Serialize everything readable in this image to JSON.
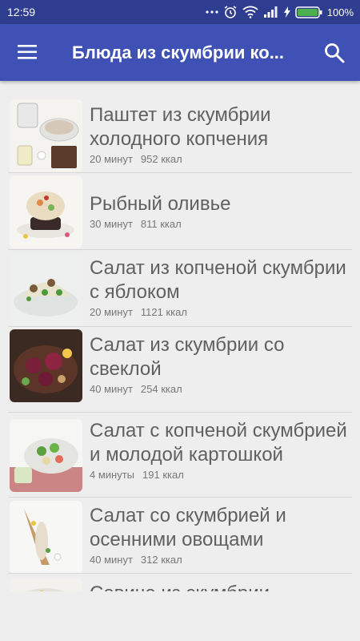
{
  "status": {
    "time": "12:59",
    "battery": "100%"
  },
  "appbar": {
    "title": "Блюда из скумбрии ко..."
  },
  "recipes": [
    {
      "name": "Паштет из скумбрии холодного копчения",
      "time": "20 минут",
      "kcal": "952 ккал"
    },
    {
      "name": "Рыбный оливье",
      "time": "30 минут",
      "kcal": "811 ккал"
    },
    {
      "name": "Салат из копченой скумбрии с яблоком",
      "time": "20 минут",
      "kcal": "1121 ккал"
    },
    {
      "name": "Салат из скумбрии со свеклой",
      "time": "40 минут",
      "kcal": "254 ккал"
    },
    {
      "name": "Салат с копченой скумбрией и молодой картошкой",
      "time": "4 минуты",
      "kcal": "191 ккал"
    },
    {
      "name": "Салат со скумбрией и осенними овощами",
      "time": "40 минут",
      "kcal": "312 ккал"
    },
    {
      "name": "Севиче из скумбрии",
      "time": "",
      "kcal": ""
    }
  ]
}
